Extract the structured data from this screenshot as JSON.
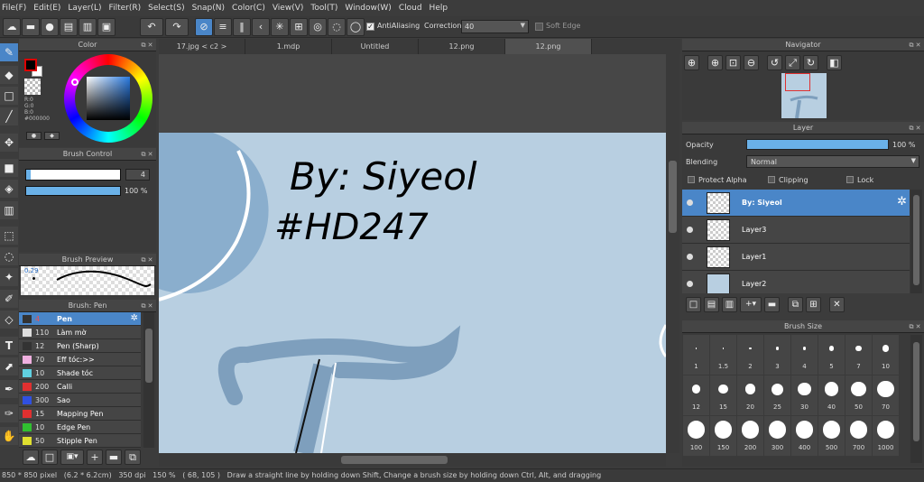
{
  "menu": [
    "File(F)",
    "Edit(E)",
    "Layer(L)",
    "Filter(R)",
    "Select(S)",
    "Snap(N)",
    "Color(C)",
    "View(V)",
    "Tool(T)",
    "Window(W)",
    "Cloud",
    "Help"
  ],
  "toolbar": {
    "antialiasing": "AntiAliasing",
    "correction": "Correction",
    "correction_value": "40",
    "soft_edge": "Soft Edge"
  },
  "tabs": [
    "17.jpg < c2 >",
    "1.mdp",
    "Untitled",
    "12.png",
    "12.png"
  ],
  "color_panel": {
    "title": "Color",
    "r": "R:0",
    "g": "G:0",
    "b": "B:0",
    "hex": "#000000"
  },
  "brush_control": {
    "title": "Brush Control",
    "size": "4",
    "opacity": "100 %"
  },
  "brush_preview": {
    "title": "Brush Preview",
    "size": "0.29"
  },
  "brush_list": {
    "title": "Brush: Pen",
    "items": [
      {
        "size": "4",
        "name": "Pen",
        "color": "#333333",
        "selected": true
      },
      {
        "size": "110",
        "name": "Làm mờ",
        "color": "#dddddd"
      },
      {
        "size": "12",
        "name": "Pen (Sharp)",
        "color": "#333333"
      },
      {
        "size": "70",
        "name": "Eff tóc:>>",
        "color": "#f0b0e0"
      },
      {
        "size": "10",
        "name": "Shade tóc",
        "color": "#60d0e0"
      },
      {
        "size": "200",
        "name": "Calli",
        "color": "#e03030"
      },
      {
        "size": "300",
        "name": "Sao",
        "color": "#3050e0"
      },
      {
        "size": "15",
        "name": "Mapping Pen",
        "color": "#e03030"
      },
      {
        "size": "10",
        "name": "Edge Pen",
        "color": "#30c030"
      },
      {
        "size": "50",
        "name": "Stipple Pen",
        "color": "#e0e030"
      }
    ]
  },
  "navigator": {
    "title": "Navigator"
  },
  "layer_panel": {
    "title": "Layer",
    "opacity_label": "Opacity",
    "opacity_value": "100 %",
    "opacity": 1.0,
    "blending_label": "Blending",
    "blending_value": "Normal",
    "protect_alpha": "Protect Alpha",
    "clipping": "Clipping",
    "lock": "Lock",
    "layers": [
      {
        "name": "By: Siyeol",
        "selected": true
      },
      {
        "name": "Layer3"
      },
      {
        "name": "Layer1"
      },
      {
        "name": "Layer2"
      }
    ]
  },
  "brush_size": {
    "title": "Brush Size",
    "sizes": [
      "1",
      "1.5",
      "2",
      "3",
      "4",
      "5",
      "7",
      "10",
      "12",
      "15",
      "20",
      "25",
      "30",
      "40",
      "50",
      "70",
      "100",
      "150",
      "200",
      "300",
      "400",
      "500",
      "700",
      "1000"
    ]
  },
  "canvas": {
    "text1": "By: Siyeol",
    "text2": "#HD247"
  },
  "status": "850 * 850 pixel   (6.2 * 6.2cm)   350 dpi   150 %   ( 68, 105 )   Draw a straight line by holding down Shift, Change a brush size by holding down Ctrl, Alt, and dragging"
}
